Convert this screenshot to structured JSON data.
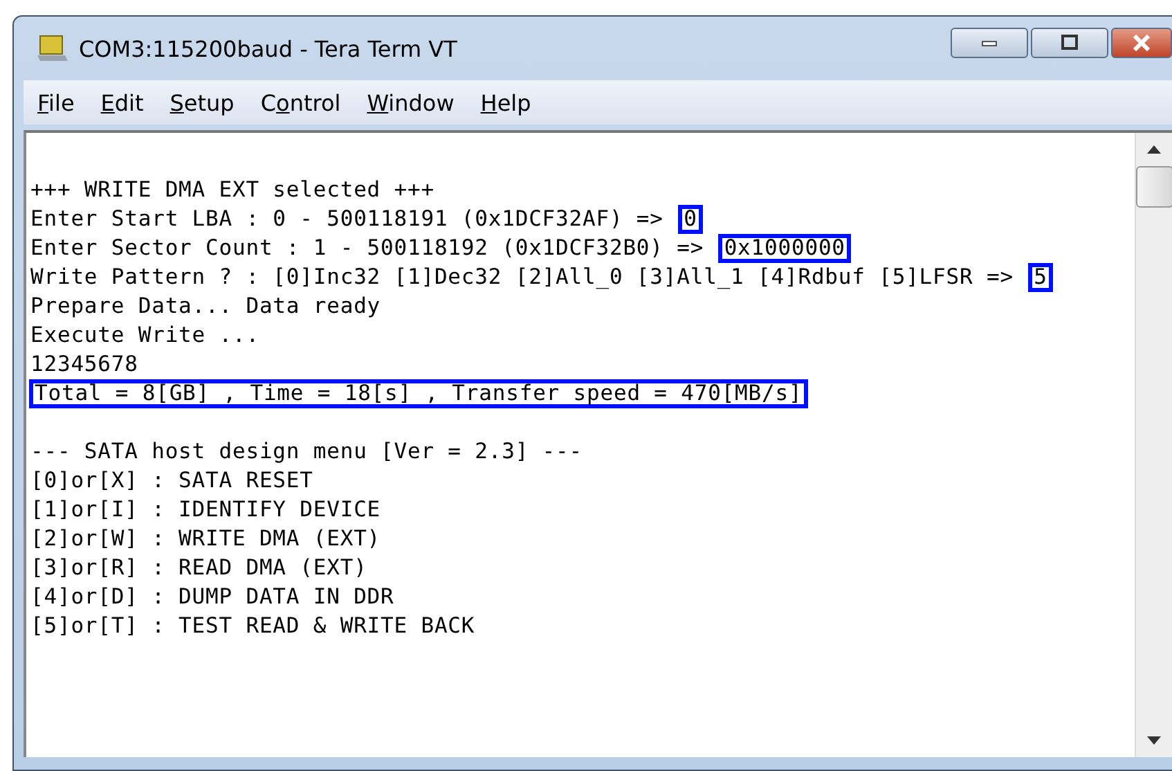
{
  "window": {
    "title": "COM3:115200baud - Tera Term VT"
  },
  "menu": [
    {
      "key": "F",
      "after": "ile"
    },
    {
      "key": "E",
      "after": "dit"
    },
    {
      "key": "S",
      "after": "etup"
    },
    {
      "before": "C",
      "key": "o",
      "after": "ntrol"
    },
    {
      "key": "W",
      "after": "indow"
    },
    {
      "key": "H",
      "after": "elp"
    }
  ],
  "terminal": {
    "lines": [
      {
        "kind": "blank"
      },
      {
        "kind": "text",
        "segments": [
          {
            "text": "+++ WRITE DMA EXT selected +++",
            "highlighted": false
          }
        ]
      },
      {
        "kind": "text",
        "segments": [
          {
            "text": "Enter Start LBA : 0 - 500118191 (0x1DCF32AF) => ",
            "highlighted": false
          },
          {
            "text": "0",
            "highlighted": true
          }
        ]
      },
      {
        "kind": "text",
        "segments": [
          {
            "text": "Enter Sector Count : 1 - 500118192 (0x1DCF32B0) => ",
            "highlighted": false
          },
          {
            "text": "0x1000000",
            "highlighted": true
          }
        ]
      },
      {
        "kind": "text",
        "segments": [
          {
            "text": "Write Pattern ? : [0]Inc32 [1]Dec32 [2]All_0 [3]All_1 [4]Rdbuf [5]LFSR => ",
            "highlighted": false
          },
          {
            "text": "5",
            "highlighted": true
          }
        ]
      },
      {
        "kind": "text",
        "segments": [
          {
            "text": "Prepare Data... Data ready",
            "highlighted": false
          }
        ]
      },
      {
        "kind": "text",
        "segments": [
          {
            "text": "Execute Write ...",
            "highlighted": false
          }
        ]
      },
      {
        "kind": "text",
        "segments": [
          {
            "text": "12345678",
            "highlighted": false
          }
        ]
      },
      {
        "kind": "text",
        "segments": [
          {
            "text": "Total = 8[GB] , Time = 18[s] , Transfer speed = 470[MB/s]",
            "highlighted": true
          }
        ]
      },
      {
        "kind": "blank"
      },
      {
        "kind": "text",
        "segments": [
          {
            "text": "--- SATA host design menu [Ver = 2.3] ---",
            "highlighted": false
          }
        ]
      },
      {
        "kind": "text",
        "segments": [
          {
            "text": "[0]or[X] : SATA RESET",
            "highlighted": false
          }
        ]
      },
      {
        "kind": "text",
        "segments": [
          {
            "text": "[1]or[I] : IDENTIFY DEVICE",
            "highlighted": false
          }
        ]
      },
      {
        "kind": "text",
        "segments": [
          {
            "text": "[2]or[W] : WRITE DMA (EXT)",
            "highlighted": false
          }
        ]
      },
      {
        "kind": "text",
        "segments": [
          {
            "text": "[3]or[R] : READ DMA (EXT)",
            "highlighted": false
          }
        ]
      },
      {
        "kind": "text",
        "segments": [
          {
            "text": "[4]or[D] : DUMP DATA IN DDR",
            "highlighted": false
          }
        ]
      },
      {
        "kind": "text",
        "segments": [
          {
            "text": "[5]or[T] : TEST READ & WRITE BACK",
            "highlighted": false
          }
        ]
      }
    ]
  }
}
